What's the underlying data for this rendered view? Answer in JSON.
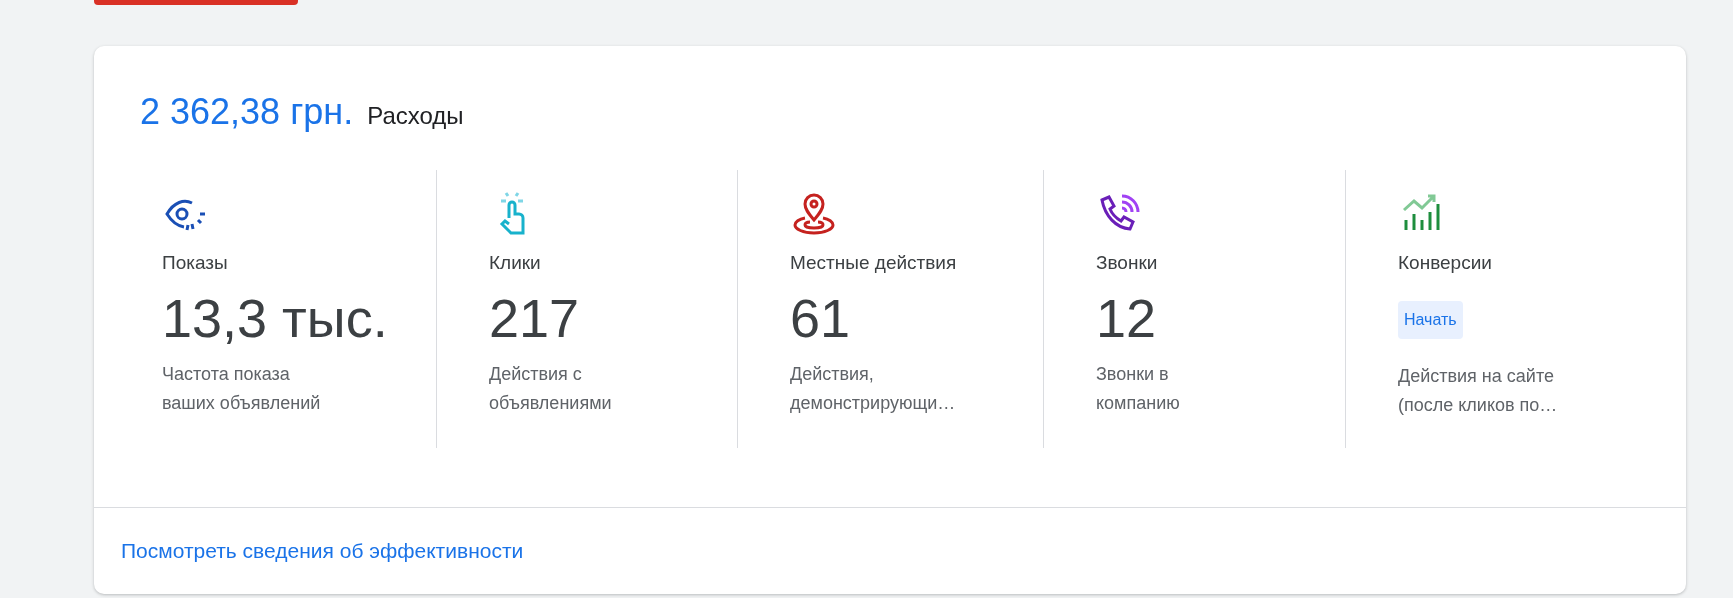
{
  "summary": {
    "amount": "2 362,38 грн.",
    "label": "Расходы"
  },
  "metrics": [
    {
      "label": "Показы",
      "value": {
        "kind": "number",
        "text": "13,3 тыс."
      },
      "description": "Частота показа\nваших объявлений"
    },
    {
      "label": "Клики",
      "value": {
        "kind": "number",
        "text": "217"
      },
      "description": "Действия с\nобъявлениями"
    },
    {
      "label": "Местные действия",
      "value": {
        "kind": "number",
        "text": "61"
      },
      "description": "Действия,\nдемонстрирующи…"
    },
    {
      "label": "Звонки",
      "value": {
        "kind": "number",
        "text": "12"
      },
      "description": "Звонки в\nкомпанию"
    },
    {
      "label": "Конверсии",
      "value": {
        "kind": "button",
        "text": "Начать"
      },
      "description": "Действия на сайте\n(после кликов по…"
    }
  ],
  "footer_link": "Посмотреть сведения об эффективности"
}
